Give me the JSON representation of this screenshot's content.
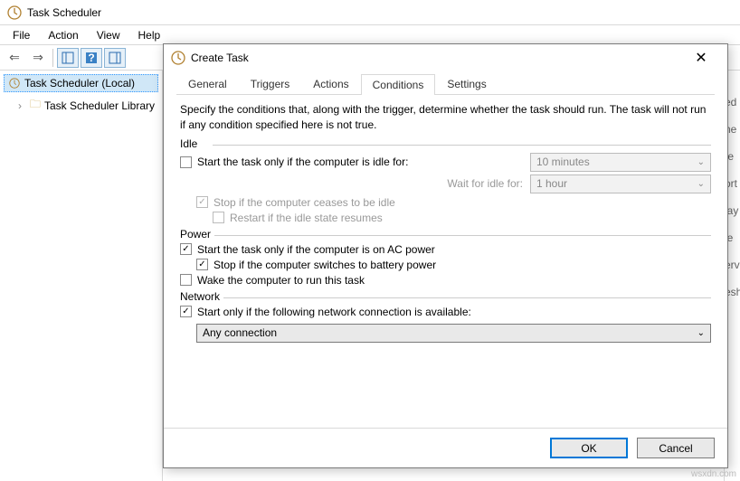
{
  "app": {
    "title": "Task Scheduler",
    "menu": [
      "File",
      "Action",
      "View",
      "Help"
    ],
    "tree": {
      "root": "Task Scheduler (Local)",
      "child": "Task Scheduler Library"
    }
  },
  "dialog": {
    "title": "Create Task",
    "tabs": [
      "General",
      "Triggers",
      "Actions",
      "Conditions",
      "Settings"
    ],
    "active_tab": "Conditions",
    "description": "Specify the conditions that, along with the trigger, determine whether the task should run.  The task will not run  if any condition specified here is not true.",
    "idle": {
      "label": "Idle",
      "start_if_idle": "Start the task only if the computer is idle for:",
      "idle_duration": "10 minutes",
      "wait_label": "Wait for idle for:",
      "wait_duration": "1 hour",
      "stop_if_cease": "Stop if the computer ceases to be idle",
      "restart_if_resume": "Restart if the idle state resumes"
    },
    "power": {
      "label": "Power",
      "ac_only": "Start the task only if the computer is on AC power",
      "stop_on_battery": "Stop if the computer switches to battery power",
      "wake": "Wake the computer to run this task"
    },
    "network": {
      "label": "Network",
      "start_if_net": "Start only if the following network connection is available:",
      "selected": "Any connection"
    },
    "buttons": {
      "ok": "OK",
      "cancel": "Cancel"
    }
  },
  "right_fragments": [
    "ed",
    "ne",
    "te",
    "ort",
    "lay",
    "le",
    "erv",
    "esh"
  ],
  "watermark": "wsxdn.com"
}
